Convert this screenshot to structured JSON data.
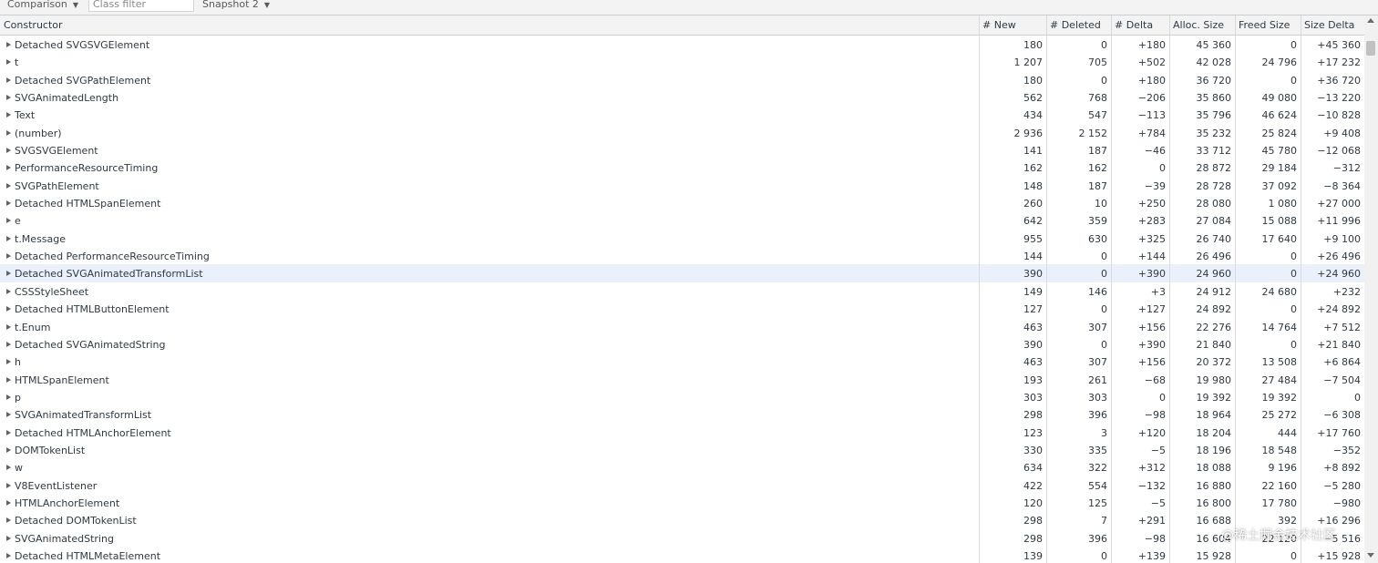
{
  "toolbar": {
    "view_mode": "Comparison",
    "class_filter_placeholder": "Class filter",
    "base_snapshot": "Snapshot 2",
    "dropdown_arrow": "▼"
  },
  "columns": [
    "Constructor",
    "# New",
    "# Deleted",
    "# Delta",
    "Alloc. Size",
    "Freed Size",
    "Size Delta"
  ],
  "rows": [
    {
      "constructor": "Detached SVGSVGElement",
      "new": "180",
      "deleted": "0",
      "delta": "+180",
      "alloc": "45 360",
      "freed": "0",
      "size_delta": "+45 360"
    },
    {
      "constructor": "t",
      "new": "1 207",
      "deleted": "705",
      "delta": "+502",
      "alloc": "42 028",
      "freed": "24 796",
      "size_delta": "+17 232"
    },
    {
      "constructor": "Detached SVGPathElement",
      "new": "180",
      "deleted": "0",
      "delta": "+180",
      "alloc": "36 720",
      "freed": "0",
      "size_delta": "+36 720"
    },
    {
      "constructor": "SVGAnimatedLength",
      "new": "562",
      "deleted": "768",
      "delta": "−206",
      "alloc": "35 860",
      "freed": "49 080",
      "size_delta": "−13 220"
    },
    {
      "constructor": "Text",
      "new": "434",
      "deleted": "547",
      "delta": "−113",
      "alloc": "35 796",
      "freed": "46 624",
      "size_delta": "−10 828"
    },
    {
      "constructor": "(number)",
      "new": "2 936",
      "deleted": "2 152",
      "delta": "+784",
      "alloc": "35 232",
      "freed": "25 824",
      "size_delta": "+9 408"
    },
    {
      "constructor": "SVGSVGElement",
      "new": "141",
      "deleted": "187",
      "delta": "−46",
      "alloc": "33 712",
      "freed": "45 780",
      "size_delta": "−12 068"
    },
    {
      "constructor": "PerformanceResourceTiming",
      "new": "162",
      "deleted": "162",
      "delta": "0",
      "alloc": "28 872",
      "freed": "29 184",
      "size_delta": "−312"
    },
    {
      "constructor": "SVGPathElement",
      "new": "148",
      "deleted": "187",
      "delta": "−39",
      "alloc": "28 728",
      "freed": "37 092",
      "size_delta": "−8 364"
    },
    {
      "constructor": "Detached HTMLSpanElement",
      "new": "260",
      "deleted": "10",
      "delta": "+250",
      "alloc": "28 080",
      "freed": "1 080",
      "size_delta": "+27 000"
    },
    {
      "constructor": "e",
      "new": "642",
      "deleted": "359",
      "delta": "+283",
      "alloc": "27 084",
      "freed": "15 088",
      "size_delta": "+11 996"
    },
    {
      "constructor": "t.Message",
      "new": "955",
      "deleted": "630",
      "delta": "+325",
      "alloc": "26 740",
      "freed": "17 640",
      "size_delta": "+9 100"
    },
    {
      "constructor": "Detached PerformanceResourceTiming",
      "new": "144",
      "deleted": "0",
      "delta": "+144",
      "alloc": "26 496",
      "freed": "0",
      "size_delta": "+26 496"
    },
    {
      "constructor": "Detached SVGAnimatedTransformList",
      "new": "390",
      "deleted": "0",
      "delta": "+390",
      "alloc": "24 960",
      "freed": "0",
      "size_delta": "+24 960",
      "selected": true
    },
    {
      "constructor": "CSSStyleSheet",
      "new": "149",
      "deleted": "146",
      "delta": "+3",
      "alloc": "24 912",
      "freed": "24 680",
      "size_delta": "+232"
    },
    {
      "constructor": "Detached HTMLButtonElement",
      "new": "127",
      "deleted": "0",
      "delta": "+127",
      "alloc": "24 892",
      "freed": "0",
      "size_delta": "+24 892"
    },
    {
      "constructor": "t.Enum",
      "new": "463",
      "deleted": "307",
      "delta": "+156",
      "alloc": "22 276",
      "freed": "14 764",
      "size_delta": "+7 512"
    },
    {
      "constructor": "Detached SVGAnimatedString",
      "new": "390",
      "deleted": "0",
      "delta": "+390",
      "alloc": "21 840",
      "freed": "0",
      "size_delta": "+21 840"
    },
    {
      "constructor": "h",
      "new": "463",
      "deleted": "307",
      "delta": "+156",
      "alloc": "20 372",
      "freed": "13 508",
      "size_delta": "+6 864"
    },
    {
      "constructor": "HTMLSpanElement",
      "new": "193",
      "deleted": "261",
      "delta": "−68",
      "alloc": "19 980",
      "freed": "27 484",
      "size_delta": "−7 504"
    },
    {
      "constructor": "p",
      "new": "303",
      "deleted": "303",
      "delta": "0",
      "alloc": "19 392",
      "freed": "19 392",
      "size_delta": "0"
    },
    {
      "constructor": "SVGAnimatedTransformList",
      "new": "298",
      "deleted": "396",
      "delta": "−98",
      "alloc": "18 964",
      "freed": "25 272",
      "size_delta": "−6 308"
    },
    {
      "constructor": "Detached HTMLAnchorElement",
      "new": "123",
      "deleted": "3",
      "delta": "+120",
      "alloc": "18 204",
      "freed": "444",
      "size_delta": "+17 760"
    },
    {
      "constructor": "DOMTokenList",
      "new": "330",
      "deleted": "335",
      "delta": "−5",
      "alloc": "18 196",
      "freed": "18 548",
      "size_delta": "−352"
    },
    {
      "constructor": "w",
      "new": "634",
      "deleted": "322",
      "delta": "+312",
      "alloc": "18 088",
      "freed": "9 196",
      "size_delta": "+8 892"
    },
    {
      "constructor": "V8EventListener",
      "new": "422",
      "deleted": "554",
      "delta": "−132",
      "alloc": "16 880",
      "freed": "22 160",
      "size_delta": "−5 280"
    },
    {
      "constructor": "HTMLAnchorElement",
      "new": "120",
      "deleted": "125",
      "delta": "−5",
      "alloc": "16 800",
      "freed": "17 780",
      "size_delta": "−980"
    },
    {
      "constructor": "Detached DOMTokenList",
      "new": "298",
      "deleted": "7",
      "delta": "+291",
      "alloc": "16 688",
      "freed": "392",
      "size_delta": "+16 296"
    },
    {
      "constructor": "SVGAnimatedString",
      "new": "298",
      "deleted": "396",
      "delta": "−98",
      "alloc": "16 604",
      "freed": "22 120",
      "size_delta": "−5 516"
    },
    {
      "constructor": "Detached HTMLMetaElement",
      "new": "139",
      "deleted": "0",
      "delta": "+139",
      "alloc": "15 928",
      "freed": "0",
      "size_delta": "+15 928"
    }
  ],
  "watermark": "@稀土掘金技术社区"
}
